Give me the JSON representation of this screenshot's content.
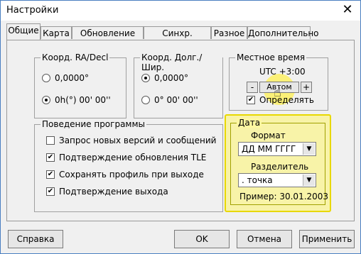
{
  "window": {
    "title": "Настройки",
    "close_label": "✕"
  },
  "tabs": [
    "Общие",
    "Карта",
    "Обновление TLE",
    "Синхр. времени",
    "Разное",
    "Дополнительно"
  ],
  "coords_radec": {
    "title": "Коорд. RA/Decl",
    "option1": "0,0000°",
    "option2": "0h(°) 00' 00''",
    "selected": 2
  },
  "coords_lonlat": {
    "title": "Коорд. Долг./Шир.",
    "option1": "0,0000°",
    "option2": "0° 00' 00''",
    "selected": 1
  },
  "local_time": {
    "title": "Местное время",
    "value": "UTC +3:00",
    "minus": "-",
    "auto": "Автом",
    "plus": "+",
    "detect_label": "Определять",
    "detect_checked": true
  },
  "behavior": {
    "title": "Поведение программы",
    "items": [
      {
        "label": "Запрос новых версий и сообщений",
        "checked": false
      },
      {
        "label": "Подтверждение обновления TLE",
        "checked": true
      },
      {
        "label": "Сохранять профиль при выходе",
        "checked": true
      },
      {
        "label": "Подтверждение выхода",
        "checked": true
      }
    ]
  },
  "date": {
    "title": "Дата",
    "format_label": "Формат",
    "format_value": "ДД ММ ГГГГ",
    "separator_label": "Разделитель",
    "separator_value": ". точка",
    "example": "Пример: 30.01.2003"
  },
  "buttons": {
    "help": "Справка",
    "ok": "OK",
    "cancel": "Отмена",
    "apply": "Применить"
  },
  "colors": {
    "highlight": "#fff26a",
    "window_border": "#4a7fc1"
  }
}
